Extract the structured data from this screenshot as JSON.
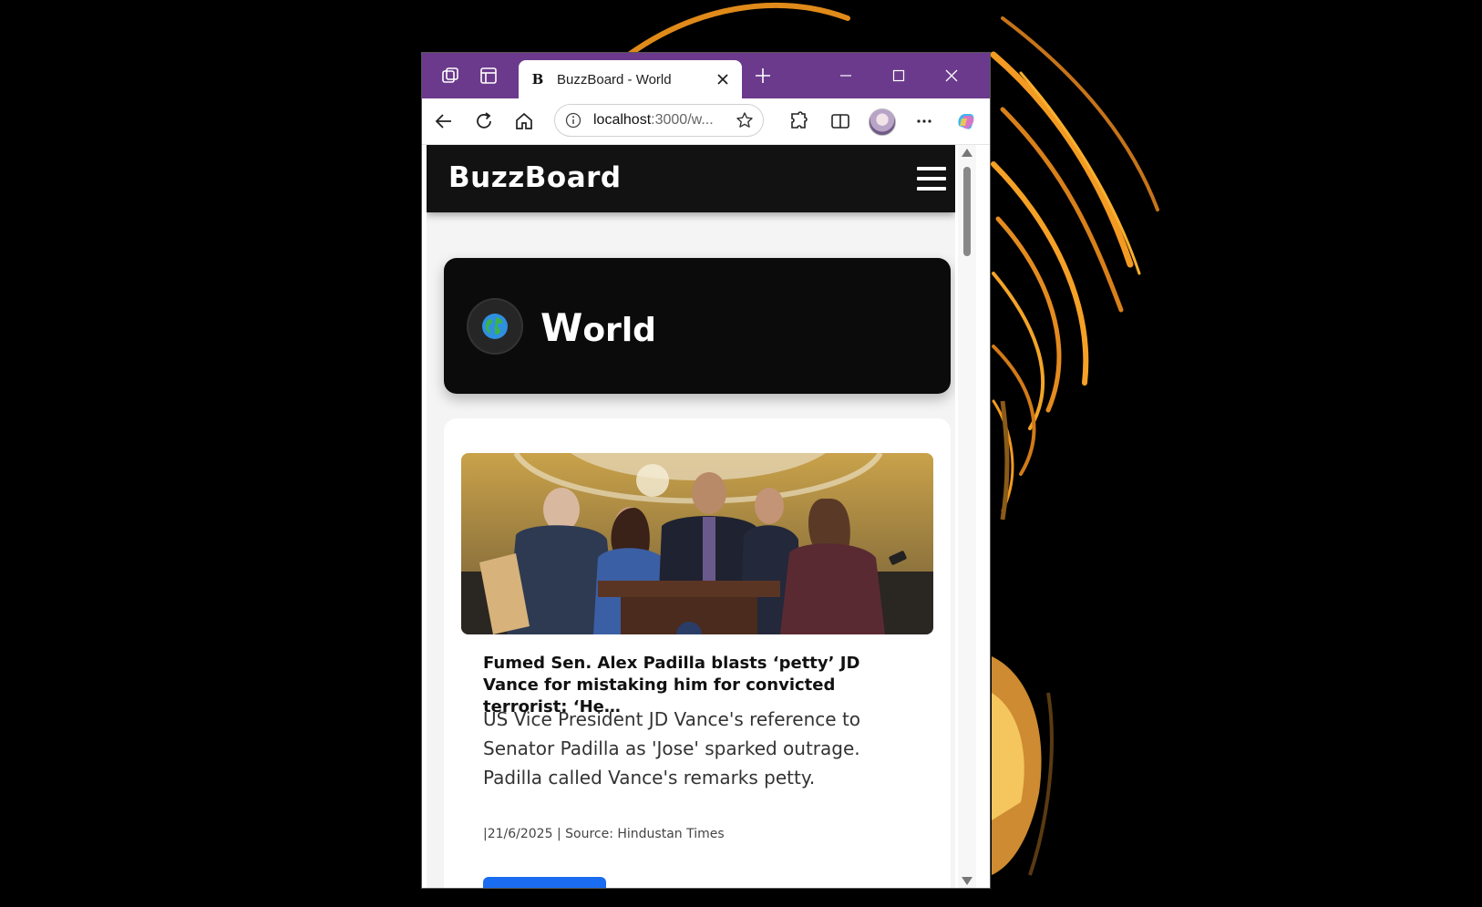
{
  "browser": {
    "tab": {
      "favicon": "B",
      "title": "BuzzBoard - World"
    },
    "address": {
      "host": "localhost",
      "rest": ":3000/w..."
    },
    "icons": [
      "workspaces-icon",
      "tab-actions-icon",
      "close-icon",
      "new-tab-icon",
      "minimize-icon",
      "maximize-icon",
      "window-close-icon",
      "back-icon",
      "refresh-icon",
      "home-icon",
      "info-icon",
      "star-icon",
      "extensions-icon",
      "split-screen-icon",
      "more-icon",
      "copilot-icon"
    ]
  },
  "site": {
    "brand": "BuzzBoard",
    "section": {
      "title_first": "W",
      "title_rest": "orld",
      "icon": "globe-icon"
    },
    "article": {
      "title": "Fumed Sen. Alex Padilla blasts ‘petty’ JD Vance for mistaking him for convicted terrorist: ‘He…",
      "description": "US Vice President JD Vance's reference to Senator Padilla as 'Jose' sparked outrage. Padilla called Vance's remarks petty.",
      "meta": "|21/6/2025 | Source: Hindustan Times"
    }
  },
  "colors": {
    "titlebar": "#6b3a8c",
    "nav": "#121212",
    "accent": "#1a6cf0"
  }
}
